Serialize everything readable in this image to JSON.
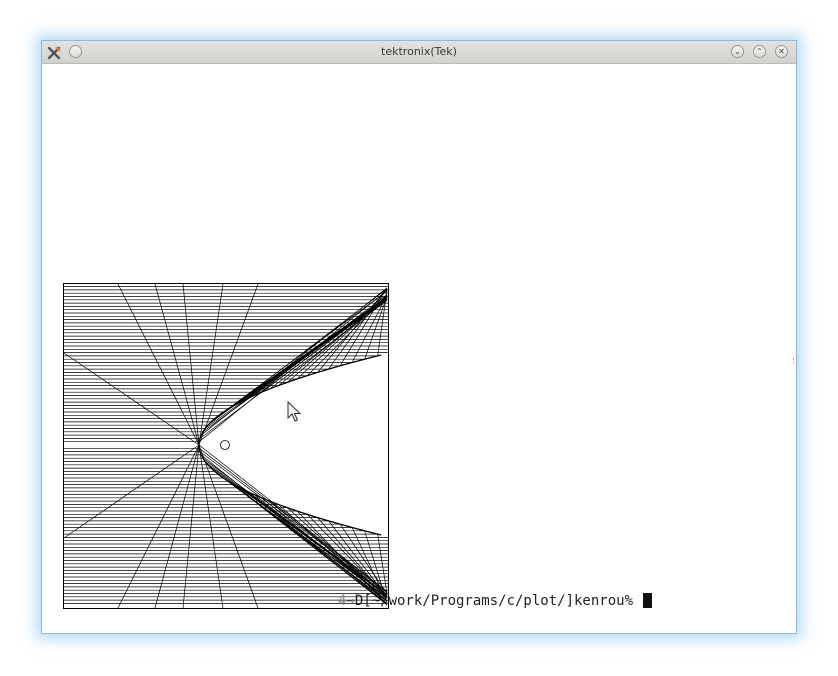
{
  "window": {
    "title": "tektronix(Tek)",
    "buttons": [
      "minimize",
      "maximize",
      "close"
    ]
  },
  "terminal": {
    "prompt_text": "D[~/work/Programs/c/plot/]kenrou%",
    "prompt_prefix_partial": "4→",
    "cursor": "block"
  },
  "plot": {
    "description_free": true,
    "line_color": "#000000"
  },
  "icons": {
    "app": "x-tools-icon",
    "menu": "circle-menu-icon",
    "pointer": "mouse-pointer-icon"
  }
}
